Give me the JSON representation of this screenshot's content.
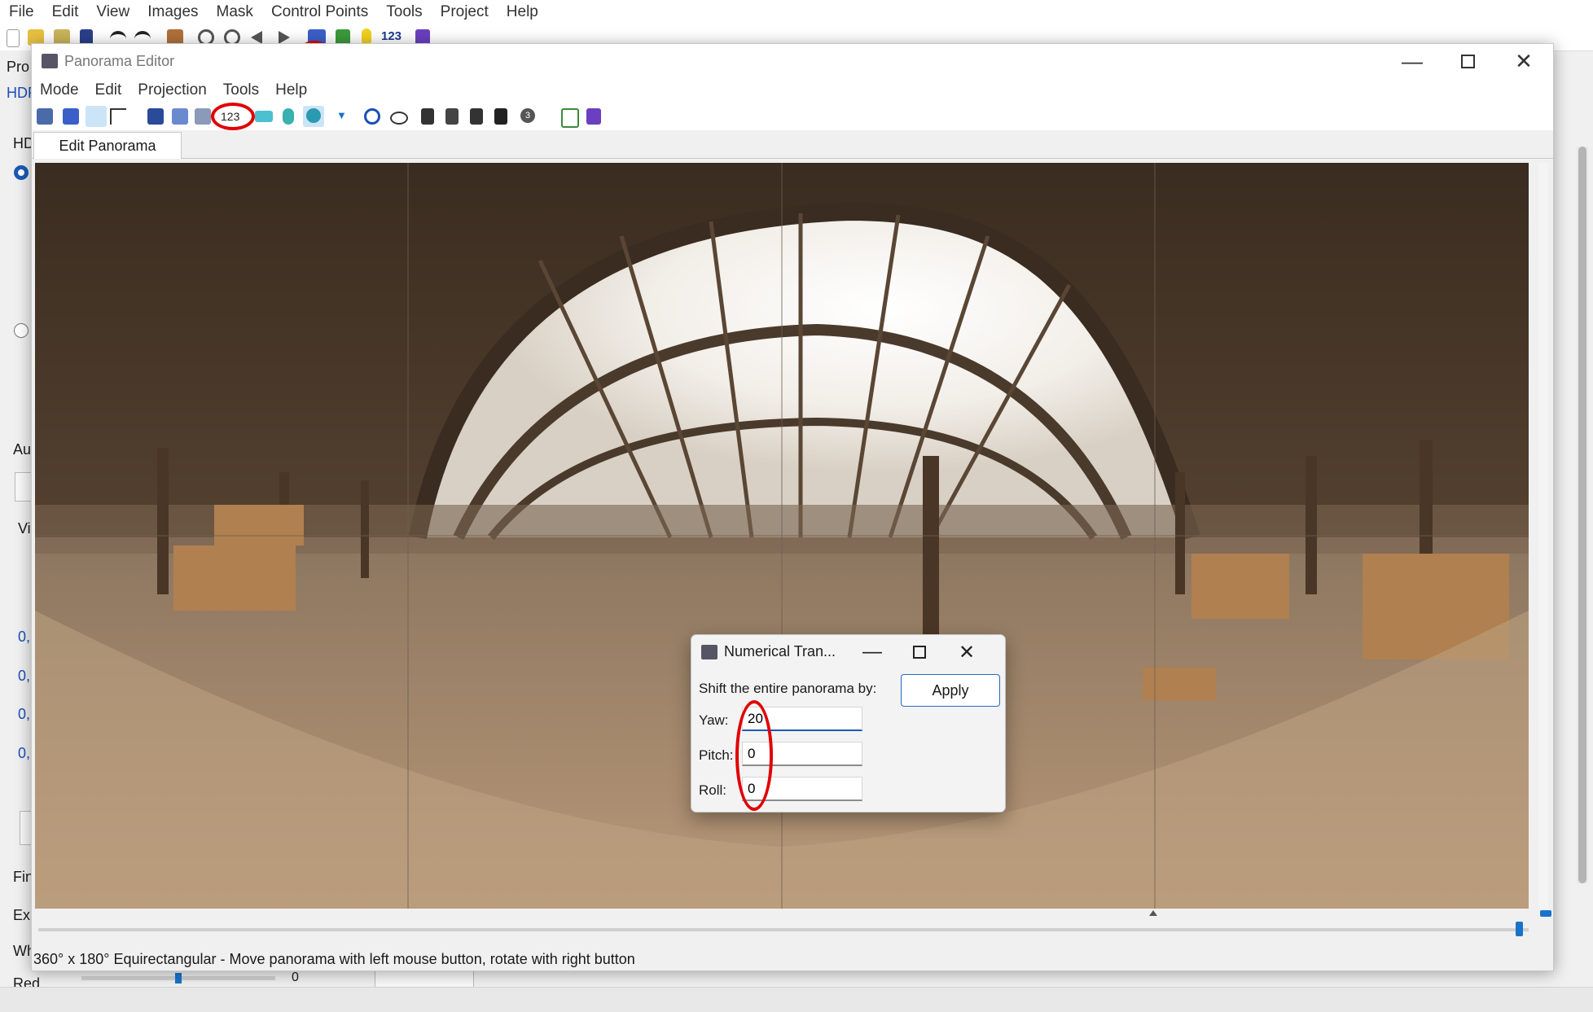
{
  "main_menu": [
    "File",
    "Edit",
    "View",
    "Images",
    "Mask",
    "Control Points",
    "Tools",
    "Project",
    "Help"
  ],
  "main_toolbar": {
    "numbers_label": "123"
  },
  "main_side": {
    "labels": [
      "Pro",
      "HDR",
      "HD",
      "Au",
      "Vi",
      "0,",
      "0,",
      "0,",
      "0,",
      "Fin",
      "Exp",
      "Wh",
      "Red"
    ],
    "slider_value": "0"
  },
  "editor": {
    "title": "Panorama Editor",
    "menu": [
      "Mode",
      "Edit",
      "Projection",
      "Tools",
      "Help"
    ],
    "toolbar": {
      "numerical_label": "123",
      "layer_badge": "3"
    },
    "tab": "Edit Panorama",
    "status": "360° x 180° Equirectangular - Move panorama with left mouse button, rotate with right button"
  },
  "dialog": {
    "title": "Numerical Tran...",
    "prompt": "Shift the entire panorama by:",
    "apply": "Apply",
    "fields": [
      {
        "label": "Yaw:",
        "value": "20"
      },
      {
        "label": "Pitch:",
        "value": "0"
      },
      {
        "label": "Roll:",
        "value": "0"
      }
    ]
  },
  "colors": {
    "accent": "#1a73c9",
    "highlight": "#e00000"
  }
}
